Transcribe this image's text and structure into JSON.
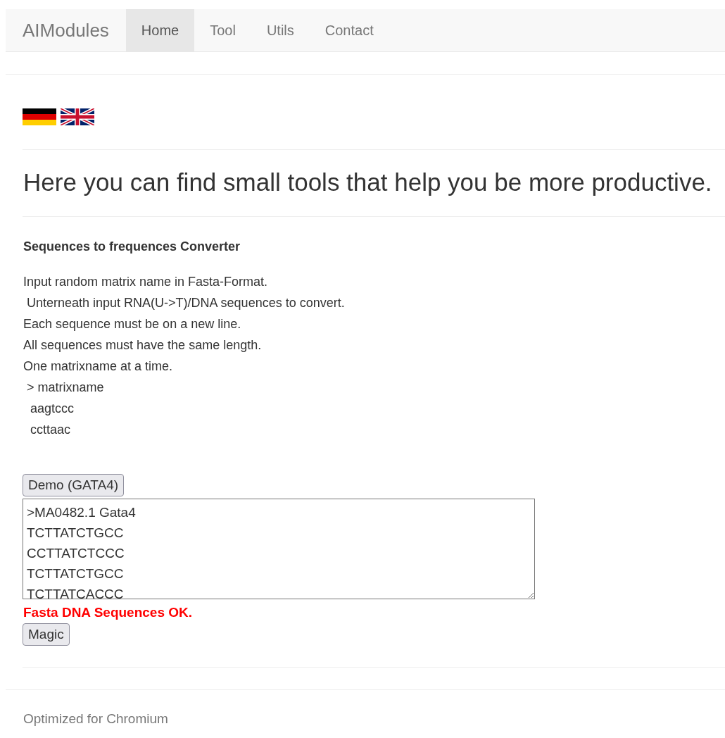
{
  "navbar": {
    "brand": "AIModules",
    "items": [
      {
        "label": "Home",
        "selected": true
      },
      {
        "label": "Tool",
        "selected": false
      },
      {
        "label": "Utils",
        "selected": false
      },
      {
        "label": "Contact",
        "selected": false
      }
    ]
  },
  "languages": [
    {
      "kind": "de"
    },
    {
      "kind": "gb"
    }
  ],
  "heading": "Here you can find small tools that help you be more productive.",
  "tool": {
    "title": "Sequences to frequences Converter",
    "instructions": [
      "Input random matrix name in Fasta-Format.",
      " Unterneath input RNA(U->T)/DNA sequences to convert.",
      "Each sequence must be on a new line.",
      "All sequences must have the same length.",
      "One matrixname at a time.",
      " > matrixname",
      "  aagtccc",
      "  ccttaac"
    ],
    "demo_button": "Demo (GATA4)",
    "input": {
      "value": ">MA0482.1 Gata4\nTCTTATCTGCC\nCCTTATCTCCC\nTCTTATCTGCC\nTCTTATCACCC"
    },
    "status": {
      "text": "Fasta DNA Sequences OK.",
      "kind": "ok"
    },
    "run_button": "Magic"
  },
  "footer": "Optimized for Chromium"
}
